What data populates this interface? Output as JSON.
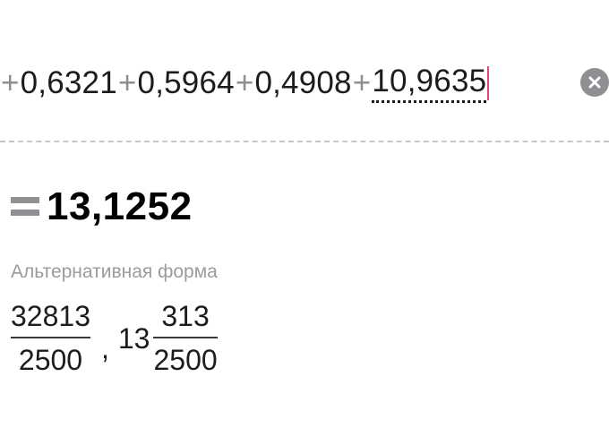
{
  "expression": {
    "terms": [
      {
        "op": "+",
        "value": "0,6321"
      },
      {
        "op": "+",
        "value": "0,5964"
      },
      {
        "op": "+",
        "value": "0,4908"
      },
      {
        "op": "+",
        "value": "10,9635"
      }
    ]
  },
  "result": {
    "value": "13,1252"
  },
  "alternative": {
    "label": "Альтернативная форма",
    "improper_fraction": {
      "numerator": "32813",
      "denominator": "2500"
    },
    "separator": ",",
    "mixed_number": {
      "whole": "13",
      "numerator": "313",
      "denominator": "2500"
    }
  },
  "colors": {
    "operator": "#8e8e93",
    "caret": "#e0457b",
    "label": "#9a9aa0"
  },
  "icons": {
    "clear": "clear-circle-x",
    "equals": "equals-sign"
  }
}
